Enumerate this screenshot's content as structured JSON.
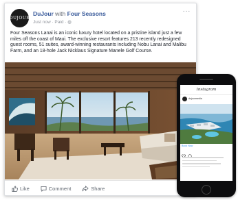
{
  "fb_post": {
    "avatar_text": "DUJOUR",
    "page_name": "DuJour",
    "with_text": "with",
    "tagged_name": "Four Seasons",
    "subline": "Just now · Paid · ◍",
    "more_label": "···",
    "body_text": "Four Seasons Lanai is an iconic luxury hotel located on a pristine island just a few miles off the coast of Maui. The exclusive resort features 213 recently redesigned guest rooms, 51 suites, award-winning restaurants including Nobu Lanai and Malibu Farm, and an 18-hole Jack Nicklaus Signature Manele Golf Course.",
    "actions": {
      "like": "Like",
      "comment": "Comment",
      "share": "Share"
    }
  },
  "phone": {
    "app_title": "Instagram",
    "username": "dujourmedia",
    "cta_text": "Book Now"
  },
  "colors": {
    "fb_link": "#365899",
    "fb_text": "#1d2129",
    "ig_link": "#3897f0",
    "phone_body": "#0d0d0f"
  }
}
